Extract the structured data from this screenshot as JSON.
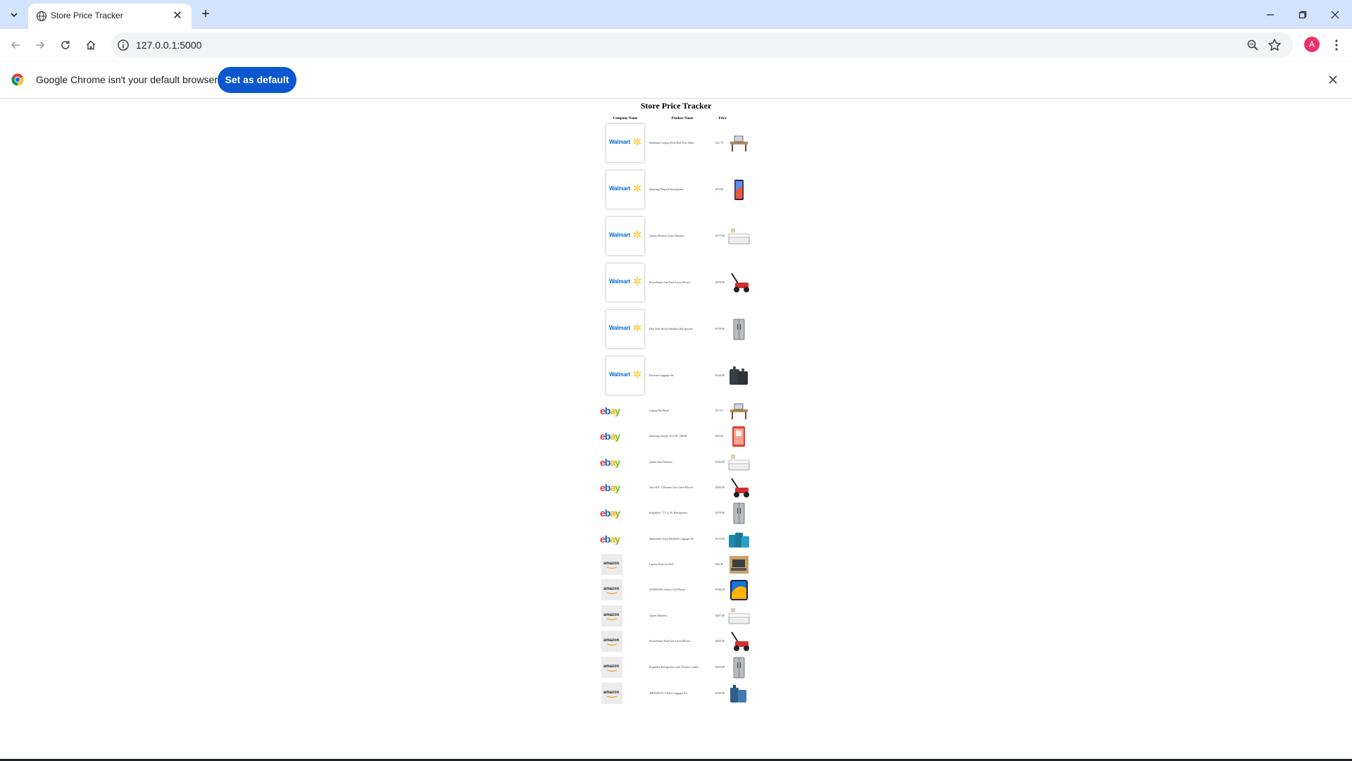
{
  "browser": {
    "tab_title": "Store Price Tracker",
    "url": "127.0.0.1:5000",
    "profile_initial": "A",
    "infobar_message": "Google Chrome isn't your default browser",
    "infobar_button": "Set as default"
  },
  "page": {
    "title": "Store Price Tracker",
    "columns": {
      "company": "Company Name",
      "product": "Product Name",
      "price": "Price"
    }
  },
  "rows": [
    {
      "company": "Walmart",
      "product": "Sonnilano Laptop Desk Bed Tray Table",
      "price": "$21.79",
      "image": "bed-tray"
    },
    {
      "company": "Walmart",
      "product": "Samsung Prepaid Smartphone",
      "price": "$79.88",
      "image": "phone"
    },
    {
      "company": "Walmart",
      "product": "Queen Memory Foam Mattress",
      "price": "$177.00",
      "image": "mattress"
    },
    {
      "company": "Walmart",
      "product": "PowerSmart Gas Push Lawn Mower",
      "price": "$278.00",
      "image": "mower"
    },
    {
      "company": "Walmart",
      "product": "Hisa Side Bosch Stainless Refrigerator",
      "price": "$718.00",
      "image": "fridge"
    },
    {
      "company": "Walmart",
      "product": "Extreme Luggage Set",
      "price": "$128.00",
      "image": "luggage-dark"
    },
    {
      "company": "ebay",
      "product": "Laptop Bed Desk",
      "price": "$17.97",
      "image": "bed-tray"
    },
    {
      "company": "ebay",
      "product": "Samsung Galaxy A12 NL 128GB",
      "price": "$93.00",
      "image": "phone-red"
    },
    {
      "company": "ebay",
      "product": "Queen Size Mattress",
      "price": "$109.99",
      "image": "mattress"
    },
    {
      "company": "ebay",
      "product": "Toro 60V 1Ultimate Gas Lawn Mower",
      "price": "$299.00",
      "image": "mower"
    },
    {
      "company": "ebay",
      "product": "Frigidaire 7.5 Cu. Ft. Refrigerator",
      "price": "$318.00",
      "image": "fridge"
    },
    {
      "company": "ebay",
      "product": "Samsonite Omni Hardside Luggage Set",
      "price": "$118.00",
      "image": "luggage-teal"
    },
    {
      "company": "amazon",
      "product": "Laptop Desk for Bed",
      "price": "$42.49",
      "image": "laptop-desk"
    },
    {
      "company": "amazon",
      "product": "SAMSUNG Galaxy Cell Phone",
      "price": "$188.00",
      "image": "phone-blue"
    },
    {
      "company": "amazon",
      "product": "Queen Mattress",
      "price": "$297.00",
      "image": "mattress"
    },
    {
      "company": "amazon",
      "product": "PowerSmart Push Gas Lawn Mower",
      "price": "$269.00",
      "image": "mower"
    },
    {
      "company": "amazon",
      "product": "Frigidaire Refrigerator with Freezer Combo",
      "price": "$329.00",
      "image": "fridge"
    },
    {
      "company": "amazon",
      "product": "SHOWKOO 3 Piece Luggage Set",
      "price": "$198.00",
      "image": "luggage-blue"
    }
  ]
}
